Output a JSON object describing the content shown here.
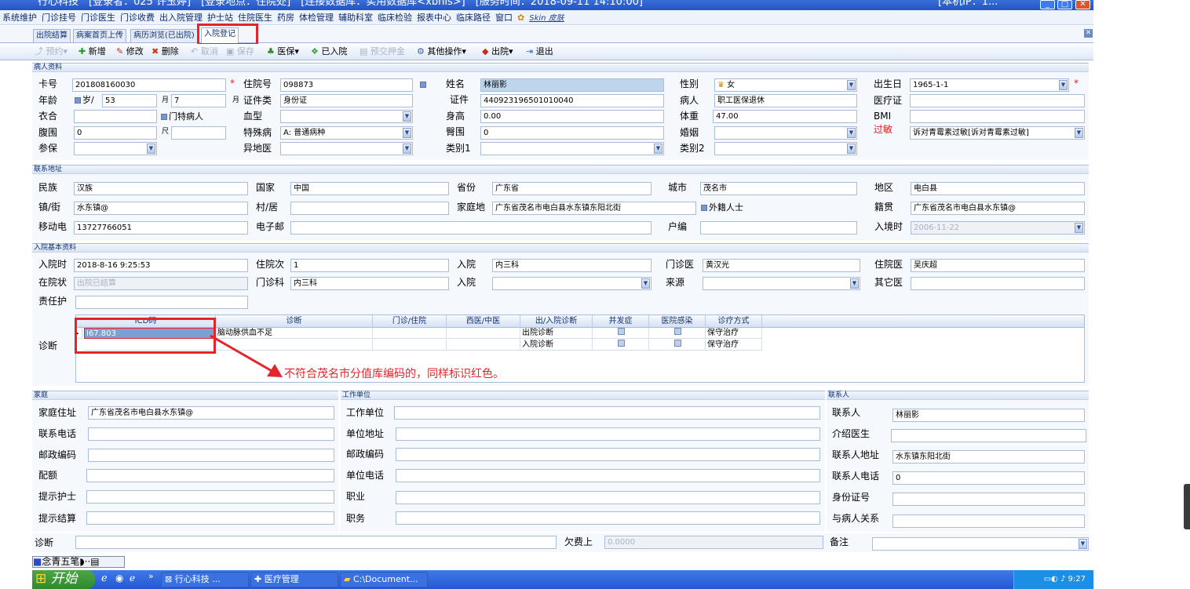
{
  "window": {
    "title": "行心科技　[登录者：025 许玉婷]　[登录地点：住院处]　[连接数据库：实用数据库<xbhis>]　[服务时间：2018-09-11 14:10:00]",
    "ip": "[本机IP：1..."
  },
  "menu": [
    "系统维护",
    "门诊挂号",
    "门诊医生",
    "门诊收费",
    "出入院管理",
    "护士站",
    "住院医生",
    "药房",
    "体检管理",
    "辅助科室",
    "临床检验",
    "报表中心",
    "临床路径",
    "窗口",
    "Skin 皮肤"
  ],
  "tabs": [
    "出院结算",
    "病案首页上传",
    "病历浏览(已出院)",
    "入院登记"
  ],
  "toolbar": [
    {
      "label": "新增",
      "icon": "add-icon",
      "enabled": true
    },
    {
      "label": "修改",
      "icon": "edit-icon",
      "enabled": true
    },
    {
      "label": "删除",
      "icon": "delete-icon",
      "enabled": true
    },
    {
      "label": "取消",
      "icon": "cancel-icon",
      "enabled": false
    },
    {
      "label": "保存",
      "icon": "save-icon",
      "enabled": false
    },
    {
      "label": "医保",
      "icon": "insurance-icon",
      "enabled": true
    },
    {
      "label": "已入院",
      "icon": "admitted-icon",
      "enabled": true
    },
    {
      "label": "预交押金",
      "icon": "deposit-icon",
      "enabled": false
    },
    {
      "label": "其他操作",
      "icon": "other-icon",
      "enabled": true
    },
    {
      "label": "出院",
      "icon": "discharge-icon",
      "enabled": true
    },
    {
      "label": "退出",
      "icon": "exit-icon",
      "enabled": true
    }
  ],
  "patient": {
    "header": "病人资料",
    "card_label": "卡号",
    "card": "201808160030",
    "admno_label": "住院号",
    "admno": "098873",
    "name_label": "姓名",
    "name": "林丽影",
    "sex_label": "性别",
    "sex": "女",
    "dob_label": "出生日",
    "dob": "1965-1-1",
    "age_label": "年龄",
    "age_unit": "岁",
    "age": "53",
    "month": "7",
    "idtype_label": "证件类",
    "idtype": "身份证",
    "idno_label": "证件",
    "idno": "440923196501010040",
    "ptype_label": "病人",
    "ptype": "职工医保退休",
    "medcard_label": "医疗证",
    "bed_label": "衣合",
    "special_flag": "门特病人",
    "blood_label": "血型",
    "height_label": "身高",
    "height": "0.00",
    "weight_label": "体重",
    "weight": "47.00",
    "bmi_label": "BMI",
    "waist_label": "腹围",
    "waist": "0",
    "disease_label": "特殊病",
    "disease": "A: 普通病种",
    "hip_label": "臀围",
    "hip": "0",
    "marriage_label": "婚姻",
    "allergy_label": "过敏",
    "allergy": "诉对青霉素过敏[诉对青霉素过敏]",
    "ins_label": "参保",
    "remote_label": "异地医",
    "cat1_label": "类别1",
    "cat2_label": "类别2"
  },
  "contact": {
    "header": "联系地址",
    "nation_label": "民族",
    "nation": "汉族",
    "country_label": "国家",
    "country": "中国",
    "province_label": "省份",
    "province": "广东省",
    "city_label": "城市",
    "city": "茂名市",
    "district_label": "地区",
    "district": "电白县",
    "town_label": "镇/街",
    "town": "水东镇@",
    "village_label": "村/居",
    "home_label": "家庭地",
    "home": "广东省茂名市电白县水东镇东阳北街",
    "foreign_label": "外籍人士",
    "native_label": "籍贯",
    "native": "广东省茂名市电白县水东镇@",
    "mobile_label": "移动电",
    "mobile": "13727766051",
    "email_label": "电子邮",
    "hukou_label": "户编",
    "entry_label": "入境时",
    "entry": "2006-11-22"
  },
  "admission": {
    "header": "入院基本资料",
    "time_label": "入院时",
    "time": "2018-8-16 9:25:53",
    "times_label": "住院次",
    "times": "1",
    "dept_label": "入院",
    "dept": "内三科",
    "opdoc_label": "门诊医",
    "opdoc": "黄汉光",
    "ipdoc_label": "住院医",
    "ipdoc": "吴庆超",
    "status_label": "在院状",
    "status": "出院已结算",
    "opdept_label": "门诊科",
    "opdept": "内三科",
    "ward_label": "入院",
    "source_label": "来源",
    "otherdoc_label": "其它医",
    "nurse_label": "责任护",
    "diag_label": "诊断"
  },
  "diag_grid": {
    "headers": [
      "ICD码",
      "诊断",
      "门诊/住院",
      "西医/中医",
      "出/入院诊断",
      "并发症",
      "医院感染",
      "诊疗方式"
    ],
    "rows": [
      {
        "icd": "I67.803",
        "diag": "脑动脉供血不足",
        "type": "出院诊断",
        "mode": "保守治疗"
      },
      {
        "icd": "",
        "diag": "",
        "type": "入院诊断",
        "mode": "保守治疗"
      }
    ]
  },
  "annotation": "不符合茂名市分值库编码的，同样标识红色。",
  "family": {
    "header": "家庭",
    "addr_label": "家庭住址",
    "addr": "广东省茂名市电白县水东镇@",
    "phone_label": "联系电话",
    "zip_label": "邮政编码",
    "quota_label": "配额",
    "nurse_label": "提示护士",
    "settle_label": "提示结算"
  },
  "work": {
    "header": "工作单位",
    "unit_label": "工作单位",
    "addr_label": "单位地址",
    "zip_label": "邮政编码",
    "phone_label": "单位电话",
    "job_label": "职业",
    "post_label": "职务"
  },
  "contactperson": {
    "header": "联系人",
    "name_label": "联系人",
    "name": "林丽影",
    "refdoc_label": "介绍医生",
    "addr_label": "联系人地址",
    "addr": "水东镇东阳北街",
    "phone_label": "联系人电话",
    "phone": "0",
    "idno_label": "身份证号",
    "relation_label": "与病人关系"
  },
  "bottom": {
    "diag_label": "诊断",
    "owe_label": "欠费上",
    "owe": "0.0000",
    "remark_label": "备注"
  },
  "taskbar": {
    "start": "开始",
    "tasks": [
      "行心科技 ...",
      "医疗管理",
      "C:\\Document..."
    ],
    "clock": "9:27",
    "ime": "念青五笔"
  }
}
